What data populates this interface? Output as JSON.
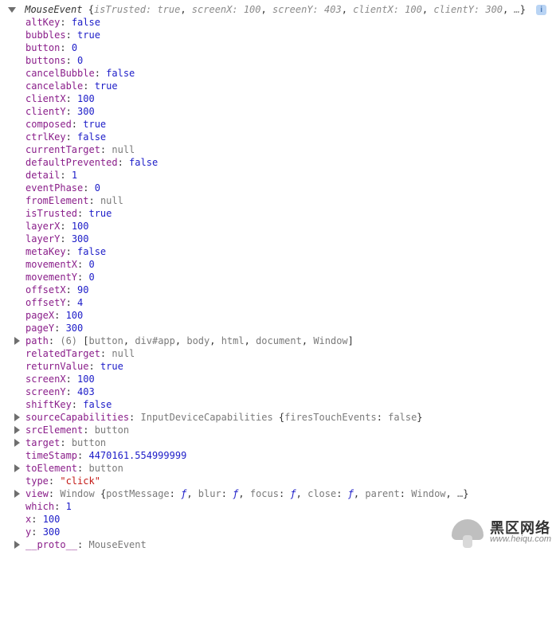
{
  "header": {
    "type_label": "MouseEvent",
    "preview_pairs": [
      {
        "k": "isTrusted",
        "v": "true"
      },
      {
        "k": "screenX",
        "v": "100"
      },
      {
        "k": "screenY",
        "v": "403"
      },
      {
        "k": "clientX",
        "v": "100"
      },
      {
        "k": "clientY",
        "v": "300"
      }
    ],
    "ellipsis": "…",
    "info_badge": "i"
  },
  "props": [
    {
      "name": "altKey",
      "kind": "bool",
      "value": "false"
    },
    {
      "name": "bubbles",
      "kind": "bool",
      "value": "true"
    },
    {
      "name": "button",
      "kind": "num",
      "value": "0"
    },
    {
      "name": "buttons",
      "kind": "num",
      "value": "0"
    },
    {
      "name": "cancelBubble",
      "kind": "bool",
      "value": "false"
    },
    {
      "name": "cancelable",
      "kind": "bool",
      "value": "true"
    },
    {
      "name": "clientX",
      "kind": "num",
      "value": "100"
    },
    {
      "name": "clientY",
      "kind": "num",
      "value": "300"
    },
    {
      "name": "composed",
      "kind": "bool",
      "value": "true"
    },
    {
      "name": "ctrlKey",
      "kind": "bool",
      "value": "false"
    },
    {
      "name": "currentTarget",
      "kind": "null",
      "value": "null"
    },
    {
      "name": "defaultPrevented",
      "kind": "bool",
      "value": "false"
    },
    {
      "name": "detail",
      "kind": "num",
      "value": "1"
    },
    {
      "name": "eventPhase",
      "kind": "num",
      "value": "0"
    },
    {
      "name": "fromElement",
      "kind": "null",
      "value": "null"
    },
    {
      "name": "isTrusted",
      "kind": "bool",
      "value": "true"
    },
    {
      "name": "layerX",
      "kind": "num",
      "value": "100"
    },
    {
      "name": "layerY",
      "kind": "num",
      "value": "300"
    },
    {
      "name": "metaKey",
      "kind": "bool",
      "value": "false"
    },
    {
      "name": "movementX",
      "kind": "num",
      "value": "0"
    },
    {
      "name": "movementY",
      "kind": "num",
      "value": "0"
    },
    {
      "name": "offsetX",
      "kind": "num",
      "value": "90"
    },
    {
      "name": "offsetY",
      "kind": "num",
      "value": "4"
    },
    {
      "name": "pageX",
      "kind": "num",
      "value": "100"
    },
    {
      "name": "pageY",
      "kind": "num",
      "value": "300"
    },
    {
      "name": "path",
      "kind": "array",
      "expandable": true,
      "prefix": "(6) ",
      "items": [
        "button",
        "div#app",
        "body",
        "html",
        "document",
        "Window"
      ]
    },
    {
      "name": "relatedTarget",
      "kind": "null",
      "value": "null"
    },
    {
      "name": "returnValue",
      "kind": "bool",
      "value": "true"
    },
    {
      "name": "screenX",
      "kind": "num",
      "value": "100"
    },
    {
      "name": "screenY",
      "kind": "num",
      "value": "403"
    },
    {
      "name": "shiftKey",
      "kind": "bool",
      "value": "false"
    },
    {
      "name": "sourceCapabilities",
      "kind": "obj",
      "expandable": true,
      "obj_type": "InputDeviceCapabilities",
      "preview": [
        {
          "k": "firesTouchEvents",
          "v": "false"
        }
      ]
    },
    {
      "name": "srcElement",
      "kind": "elem",
      "expandable": true,
      "value": "button"
    },
    {
      "name": "target",
      "kind": "elem",
      "expandable": true,
      "value": "button"
    },
    {
      "name": "timeStamp",
      "kind": "num",
      "value": "4470161.554999999"
    },
    {
      "name": "toElement",
      "kind": "elem",
      "expandable": true,
      "value": "button"
    },
    {
      "name": "type",
      "kind": "str",
      "value": "\"click\""
    },
    {
      "name": "view",
      "kind": "obj",
      "expandable": true,
      "obj_type": "Window",
      "preview": [
        {
          "k": "postMessage",
          "v": "ƒ",
          "func": true
        },
        {
          "k": "blur",
          "v": "ƒ",
          "func": true
        },
        {
          "k": "focus",
          "v": "ƒ",
          "func": true
        },
        {
          "k": "close",
          "v": "ƒ",
          "func": true
        },
        {
          "k": "parent",
          "v": "Window"
        }
      ],
      "preview_ellipsis": "…"
    },
    {
      "name": "which",
      "kind": "num",
      "value": "1"
    },
    {
      "name": "x",
      "kind": "num",
      "value": "100"
    },
    {
      "name": "y",
      "kind": "num",
      "value": "300"
    },
    {
      "name": "__proto__",
      "kind": "elem",
      "expandable": true,
      "value": "MouseEvent"
    }
  ],
  "watermark": {
    "cn": "黑区网络",
    "en": "www.heiqu.com"
  }
}
